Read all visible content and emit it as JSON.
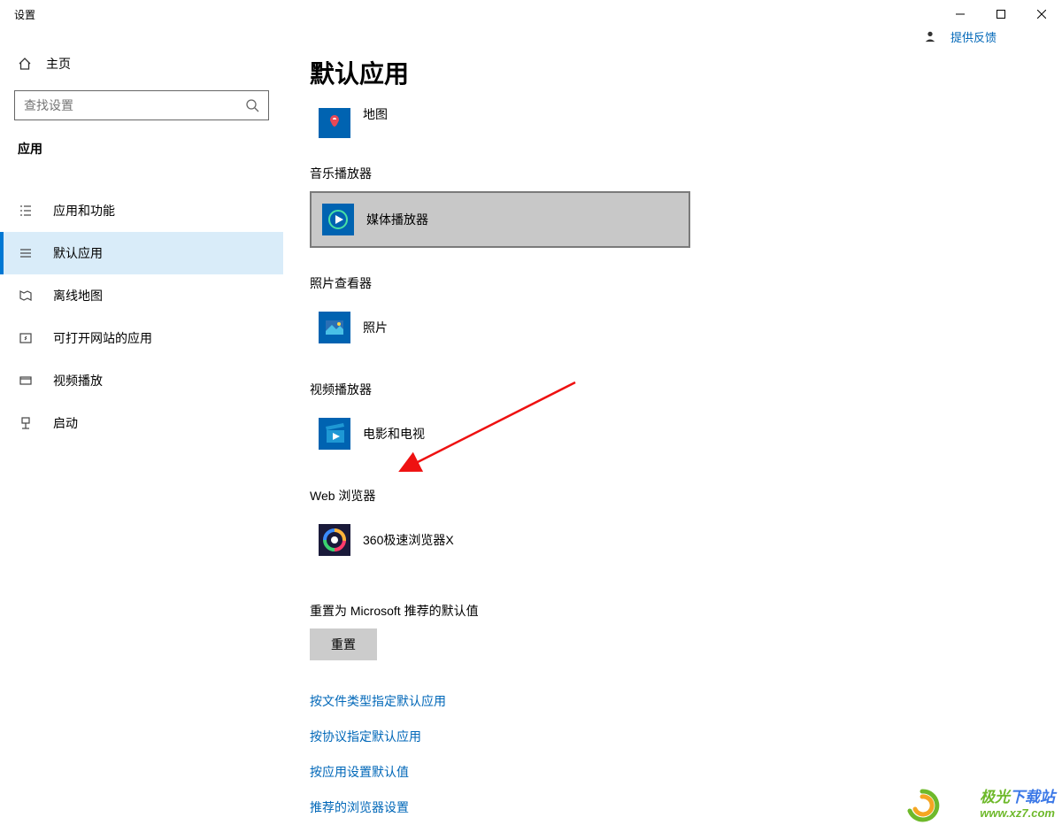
{
  "window": {
    "title": "设置"
  },
  "sidebar": {
    "home": "主页",
    "search_placeholder": "查找设置",
    "section": "应用",
    "items": [
      {
        "label": "应用和功能"
      },
      {
        "label": "默认应用"
      },
      {
        "label": "离线地图"
      },
      {
        "label": "可打开网站的应用"
      },
      {
        "label": "视频播放"
      },
      {
        "label": "启动"
      }
    ]
  },
  "content": {
    "page_title": "默认应用",
    "maps_partial_label": "地图",
    "categories": {
      "music": {
        "label": "音乐播放器",
        "app": "媒体播放器"
      },
      "photo": {
        "label": "照片查看器",
        "app": "照片"
      },
      "video": {
        "label": "视频播放器",
        "app": "电影和电视"
      },
      "web": {
        "label": "Web 浏览器",
        "app": "360极速浏览器X"
      }
    },
    "reset": {
      "label": "重置为 Microsoft 推荐的默认值",
      "button": "重置"
    },
    "links": [
      "按文件类型指定默认应用",
      "按协议指定默认应用",
      "按应用设置默认值",
      "推荐的浏览器设置"
    ],
    "feedback": "提供反馈"
  },
  "watermark": {
    "line1_a": "极光",
    "line1_b": "下载站",
    "line2": "www.xz7.com"
  }
}
